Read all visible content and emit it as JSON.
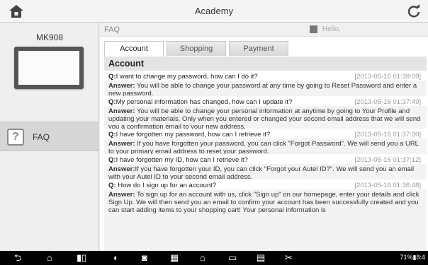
{
  "header": {
    "title": "Academy",
    "home_icon": "home-icon",
    "refresh_icon": "refresh-icon"
  },
  "sidebar": {
    "device_name": "MK908",
    "faq_label": "FAQ",
    "faq_icon": "question-icon"
  },
  "main": {
    "breadcrumb": "FAQ",
    "hello": "Hello,",
    "tabs": [
      "Account",
      "Shopping",
      "Payment"
    ],
    "section_title": "Account",
    "qa": [
      {
        "q_prefix": "Q:",
        "q": "I want to change my password, how can I do it?",
        "date": "[2013-05-16 01:38:09]",
        "a_label": "Answer:",
        "a": " You will be able to change your password at any time by going to Reset Password and enter a new password."
      },
      {
        "q_prefix": "Q:",
        "q": "My personal information has changed, how can I update it?",
        "date": "[2013-05-16 01:37:49]",
        "a_label": "Answer:",
        "a": " You will be able to change your personal information at anytime by going to Your Profile and updating your materials. Only when you entered or changed your second email address that we will send you a confirmation email to your new address."
      },
      {
        "q_prefix": "Q:",
        "q": "I have forgotten my password, how can I retrieve it?",
        "date": "[2013-05-16 01:37:30]",
        "a_label": "Answer:",
        "a": " If you have forgotten your password, you can click \"Forgot Password\". We will send you a URL to your primary email address to reset your password."
      },
      {
        "q_prefix": "Q:",
        "q": "I have forgotten my ID, how can I retrieve it?",
        "date": "[2013-05-16 01:37:12]",
        "a_label": "Answer:",
        "a": "If you have forgotten your ID, you can click \"Forgot your Autel ID?\". We will send you an email with your Autel ID to your second email address."
      },
      {
        "q_prefix": "Q:",
        "q": " How do I sign up for an account?",
        "date": "[2013-05-16 01:36:48]",
        "a_label": "Answer:",
        "a": " To sign up for an account with us, click \"Sign up\" on our homepage, enter your details and click Sign Up. We will then send you an email to confirm your account has been successfully created and you can start adding items to your shopping cart! Your personal information is"
      }
    ]
  },
  "navbar": {
    "status_text": "71%▮8:4"
  }
}
